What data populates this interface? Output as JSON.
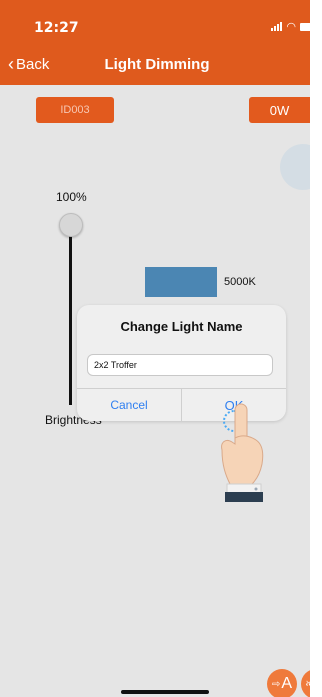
{
  "status_bar": {
    "time": "12:27",
    "icons": [
      "signal-icon",
      "wifi-icon",
      "battery-icon"
    ]
  },
  "nav": {
    "back_label": "Back",
    "title": "Light Dimming"
  },
  "controls": {
    "light_id": "ID003",
    "power": "0W",
    "brightness_percent": "100%",
    "brightness_level": 1.0,
    "brightness_label": "Brightness",
    "color_temp": "5000K"
  },
  "dialog": {
    "title": "Change Light Name",
    "input_value": "2x2 Troffer",
    "cancel_label": "Cancel",
    "ok_label": "OK"
  },
  "fabs": {
    "auto_label": "A"
  },
  "colors": {
    "accent": "#df5a1d",
    "link": "#2f7ff0",
    "swatch": "#4b86b3"
  }
}
